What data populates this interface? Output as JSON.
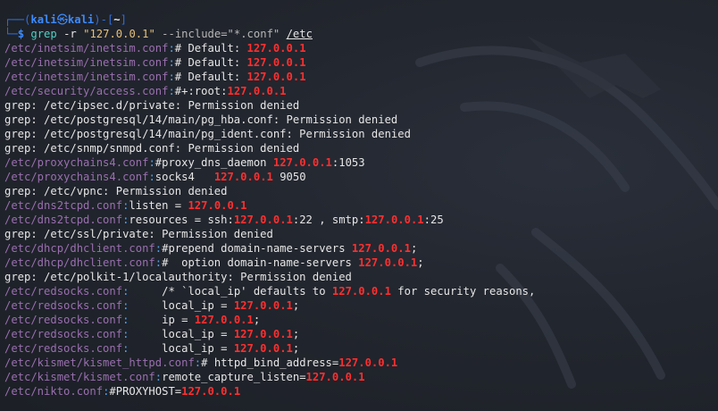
{
  "prompt": {
    "frame_top": "┌──(",
    "user": "kali",
    "skull": "㉿",
    "host": "kali",
    "frame_mid": ")-[",
    "cwd": "~",
    "frame_end": "]",
    "frame_bottom": "└─",
    "dollar": "$",
    "command": "grep",
    "flag": "-r",
    "pattern": "\"127.0.0.1\"",
    "include": "--include=\"*.conf\"",
    "target": "/etc"
  },
  "output": [
    {
      "type": "match",
      "file": "/etc/inetsim/inetsim.conf",
      "pre": "# Default: ",
      "match": "127.0.0.1",
      "post": ""
    },
    {
      "type": "match",
      "file": "/etc/inetsim/inetsim.conf",
      "pre": "# Default: ",
      "match": "127.0.0.1",
      "post": ""
    },
    {
      "type": "match",
      "file": "/etc/inetsim/inetsim.conf",
      "pre": "# Default: ",
      "match": "127.0.0.1",
      "post": ""
    },
    {
      "type": "match",
      "file": "/etc/security/access.conf",
      "pre": "#+:root:",
      "match": "127.0.0.1",
      "post": ""
    },
    {
      "type": "error",
      "text": "grep: /etc/ipsec.d/private: Permission denied"
    },
    {
      "type": "error",
      "text": "grep: /etc/postgresql/14/main/pg_hba.conf: Permission denied"
    },
    {
      "type": "error",
      "text": "grep: /etc/postgresql/14/main/pg_ident.conf: Permission denied"
    },
    {
      "type": "error",
      "text": "grep: /etc/snmp/snmpd.conf: Permission denied"
    },
    {
      "type": "match",
      "file": "/etc/proxychains4.conf",
      "pre": "#proxy_dns_daemon ",
      "match": "127.0.0.1",
      "post": ":1053"
    },
    {
      "type": "match",
      "file": "/etc/proxychains4.conf",
      "pre": "socks4   ",
      "match": "127.0.0.1",
      "post": " 9050"
    },
    {
      "type": "error",
      "text": "grep: /etc/vpnc: Permission denied"
    },
    {
      "type": "match",
      "file": "/etc/dns2tcpd.conf",
      "pre": "listen = ",
      "match": "127.0.0.1",
      "post": ""
    },
    {
      "type": "match2",
      "file": "/etc/dns2tcpd.conf",
      "pre": "resources = ssh:",
      "match": "127.0.0.1",
      "mid": ":22 , smtp:",
      "match2": "127.0.0.1",
      "post": ":25"
    },
    {
      "type": "error",
      "text": "grep: /etc/ssl/private: Permission denied"
    },
    {
      "type": "match",
      "file": "/etc/dhcp/dhclient.conf",
      "pre": "#prepend domain-name-servers ",
      "match": "127.0.0.1",
      "post": ";"
    },
    {
      "type": "match",
      "file": "/etc/dhcp/dhclient.conf",
      "pre": "#  option domain-name-servers ",
      "match": "127.0.0.1",
      "post": ";"
    },
    {
      "type": "error",
      "text": "grep: /etc/polkit-1/localauthority: Permission denied"
    },
    {
      "type": "match",
      "file": "/etc/redsocks.conf",
      "pre": "     /* `local_ip' defaults to ",
      "match": "127.0.0.1",
      "post": " for security reasons,"
    },
    {
      "type": "match",
      "file": "/etc/redsocks.conf",
      "pre": "     local_ip = ",
      "match": "127.0.0.1",
      "post": ";"
    },
    {
      "type": "match",
      "file": "/etc/redsocks.conf",
      "pre": "     ip = ",
      "match": "127.0.0.1",
      "post": ";"
    },
    {
      "type": "match",
      "file": "/etc/redsocks.conf",
      "pre": "     local_ip = ",
      "match": "127.0.0.1",
      "post": ";"
    },
    {
      "type": "match",
      "file": "/etc/redsocks.conf",
      "pre": "     local_ip = ",
      "match": "127.0.0.1",
      "post": ";"
    },
    {
      "type": "match",
      "file": "/etc/kismet/kismet_httpd.conf",
      "pre": "# httpd_bind_address=",
      "match": "127.0.0.1",
      "post": ""
    },
    {
      "type": "match",
      "file": "/etc/kismet/kismet.conf",
      "pre": "remote_capture_listen=",
      "match": "127.0.0.1",
      "post": ""
    },
    {
      "type": "match",
      "file": "/etc/nikto.conf",
      "pre": "#PROXYHOST=",
      "match": "127.0.0.1",
      "post": ""
    }
  ],
  "colors": {
    "background": "#1f2229",
    "filename": "#9a6fb0",
    "separator": "#4fa3f0",
    "match": "#ff2f2f",
    "prompt": "#3d8bff"
  }
}
